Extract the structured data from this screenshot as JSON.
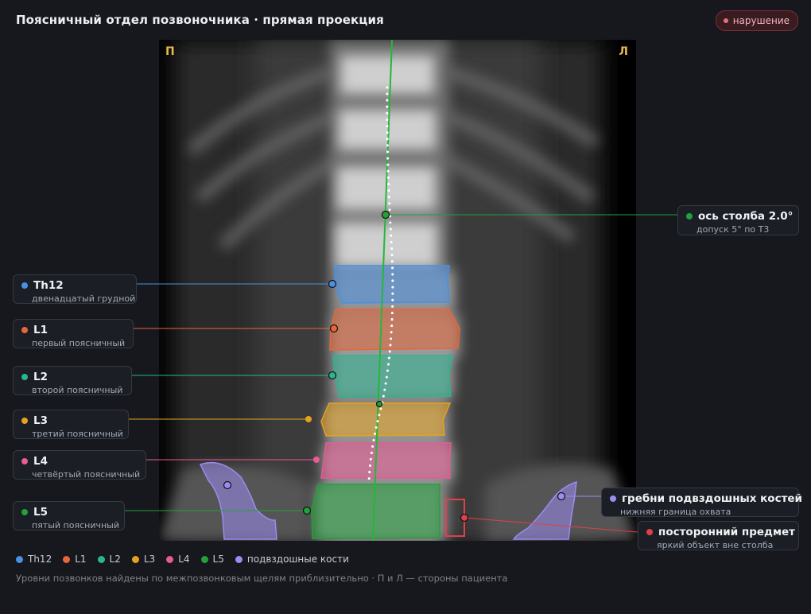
{
  "title": "Поясничный отдел позвоночника · прямая проекция",
  "status_badge": "нарушение",
  "colors": {
    "Th12": "#4a90e2",
    "L1": "#e8663a",
    "L2": "#2bb58f",
    "L3": "#e6a21f",
    "L4": "#ea5a93",
    "L5": "#23a03a",
    "iliac": "#9a8cf0",
    "axis": "#23b83a",
    "foreign": "#e0404a",
    "danger_badge": "#e5717c"
  },
  "viewer": {
    "left_side_marker": "П",
    "right_side_marker": "Л"
  },
  "labels": [
    {
      "key": "axis",
      "title": "ось столба 2.0°",
      "subtitle": "допуск 5° по Т3"
    },
    {
      "key": "Th12",
      "title": "Th12",
      "subtitle": "двенадцатый грудной"
    },
    {
      "key": "L1",
      "title": "L1",
      "subtitle": "первый поясничный"
    },
    {
      "key": "L2",
      "title": "L2",
      "subtitle": "второй поясничный"
    },
    {
      "key": "L3",
      "title": "L3",
      "subtitle": "третий поясничный"
    },
    {
      "key": "L4",
      "title": "L4",
      "subtitle": "четвёртый поясничный"
    },
    {
      "key": "L5",
      "title": "L5",
      "subtitle": "пятый поясничный"
    },
    {
      "key": "iliac",
      "title": "гребни подвздошных костей",
      "subtitle": "нижняя граница охвата"
    },
    {
      "key": "foreign",
      "title": "посторонний предмет",
      "subtitle": "яркий объект вне столба"
    }
  ],
  "legend": [
    {
      "key": "Th12",
      "label": "Th12"
    },
    {
      "key": "L1",
      "label": "L1"
    },
    {
      "key": "L2",
      "label": "L2"
    },
    {
      "key": "L3",
      "label": "L3"
    },
    {
      "key": "L4",
      "label": "L4"
    },
    {
      "key": "L5",
      "label": "L5"
    },
    {
      "key": "iliac",
      "label": "подвздошные кости"
    }
  ],
  "footnote": "Уровни позвонков найдены по межпозвонковым щелям приблизительно · П и Л — стороны пациента"
}
